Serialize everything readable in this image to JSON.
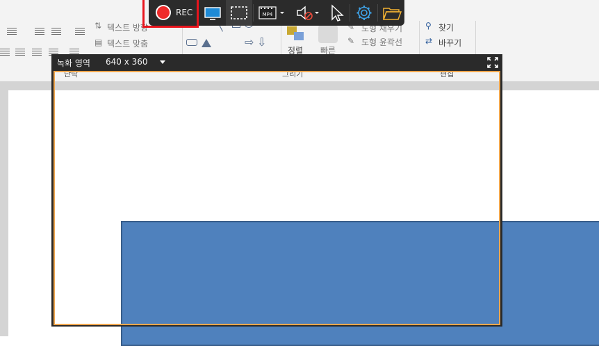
{
  "ribbon": {
    "paragraph": {
      "text_direction_label": "텍스트 방향",
      "text_align_label": "텍스트 맞춤"
    },
    "arrange_label": "정렬",
    "quick_styles_label": "빠른",
    "shape_effects_label": "도형 채우기",
    "shape_outline_label": "도형 윤곽선",
    "editing": {
      "find_label": "찾기",
      "replace_label": "바꾸기"
    },
    "group_labels": {
      "paragraph": "단락",
      "drawing": "그리기",
      "editing": "편집"
    }
  },
  "recorder": {
    "rec_label": "REC",
    "buttons": [
      "screen-capture",
      "region-select",
      "mp4-format",
      "audio-muted",
      "cursor",
      "settings",
      "open-folder"
    ],
    "format_label": "MP4",
    "region": {
      "label": "녹화 영역",
      "size": "640 x 360"
    }
  },
  "colors": {
    "rec_red": "#ee2b2b",
    "highlight_red": "#e8141c",
    "region_border": "#f0a64d",
    "toolbar_bg": "#2b2b2b",
    "shape_blue": "#4f81bd"
  }
}
